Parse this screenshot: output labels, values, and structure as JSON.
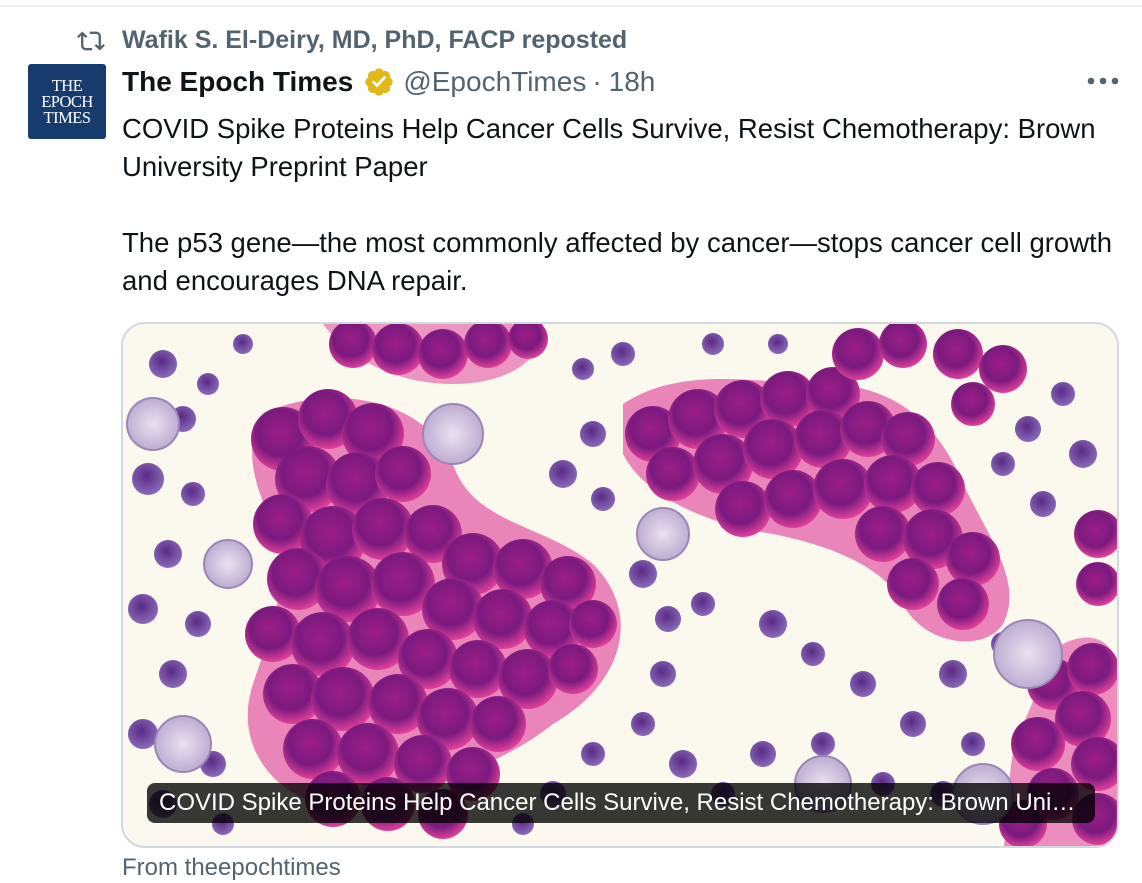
{
  "repost": {
    "text": "Wafik S. El-Deiry, MD, PhD, FACP reposted",
    "icon": "repost-icon"
  },
  "author": {
    "avatar_lines": [
      "THE",
      "EPOCH",
      "TIMES"
    ],
    "display_name": "The Epoch Times",
    "verified_icon": "verified-gold-badge-icon",
    "handle": "@EpochTimes",
    "separator": "·",
    "time": "18h"
  },
  "more_icon": "more-horizontal-icon",
  "tweet": {
    "line1": "COVID Spike Proteins Help Cancer Cells Survive, Resist Chemotherapy: Brown University Preprint Paper",
    "line2": "The p53 gene—the most commonly affected by cancer—stops cancer cell growth and encourages DNA repair."
  },
  "media": {
    "caption": "COVID Spike Proteins Help Cancer Cells Survive, Resist Chemotherapy: Brown University Preprint Paper"
  },
  "cutoff_text": "From theepochtimes",
  "colors": {
    "secondary_text": "#536471",
    "verified_gold": "#e2b719",
    "card_border": "#cfd9de",
    "avatar_bg": "#163b6c",
    "cell_magenta": "#c0278f",
    "cell_purple": "#6a2a8c"
  }
}
